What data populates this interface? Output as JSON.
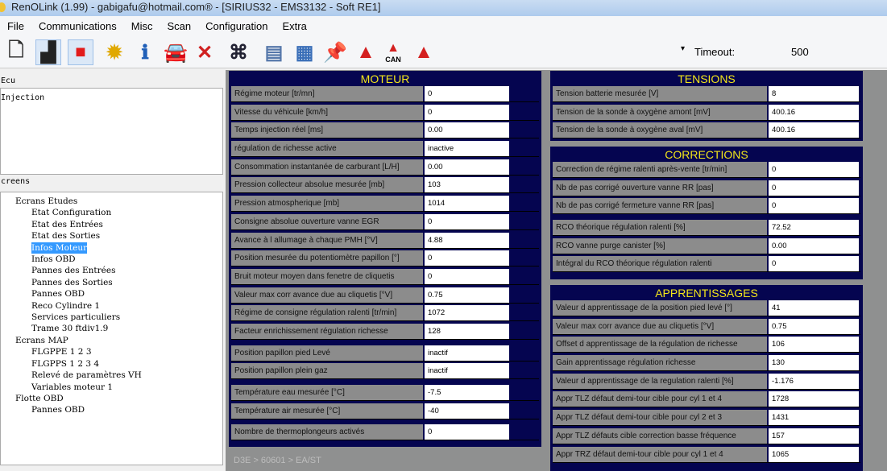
{
  "title": "RenOLink (1.99) - gabigafu@hotmail.com® -  [SIRIUS32 - EMS3132 - Soft RE1]",
  "menu": [
    "File",
    "Communications",
    "Misc",
    "Scan",
    "Configuration",
    "Extra"
  ],
  "toolbar": {
    "icons": [
      "new-file",
      "step",
      "stop",
      "gear",
      "info",
      "car-scan",
      "close",
      "binoculars",
      "shredder",
      "control-panel",
      "pin",
      "warning",
      "warning-can",
      "warning-clear"
    ],
    "can_label": "CAN",
    "timeout_label": "Timeout:",
    "timeout_value": "500"
  },
  "left": {
    "ecu_label": "Ecu",
    "ecu_items": [
      "Injection"
    ],
    "screens_label": "creens",
    "tree": [
      {
        "label": "Ecrans Etudes",
        "children": [
          "Etat Configuration",
          "Etat des Entrées",
          "Etat des Sorties",
          "Infos Moteur",
          "Infos OBD",
          "Pannes des Entrées",
          "Pannes des Sorties",
          "Pannes OBD",
          "Reco Cylindre 1",
          "Services particuliers",
          "Trame 30 ftdiv1.9"
        ]
      },
      {
        "label": "Ecrans MAP",
        "children": [
          "FLGPPE 1 2 3",
          "FLGPPS 1 2 3 4",
          "Relevé de paramètres VH",
          "Variables moteur 1"
        ]
      },
      {
        "label": "Flotte OBD",
        "children": [
          "Pannes OBD"
        ]
      }
    ],
    "selected": "Infos Moteur"
  },
  "panels": {
    "moteur": {
      "title": "MOTEUR",
      "groups": [
        [
          [
            "Régime moteur [tr/mn]",
            "0"
          ],
          [
            "Vitesse du véhicule [km/h]",
            "0"
          ],
          [
            "Temps injection réel [ms]",
            "0.00"
          ],
          [
            "régulation de richesse active",
            "inactive"
          ],
          [
            "Consommation instantanée de carburant [L/H]",
            "0.00"
          ],
          [
            "Pression collecteur absolue mesurée [mb]",
            "103"
          ],
          [
            "Pression atmospherique [mb]",
            "1014"
          ],
          [
            "Consigne absolue ouverture vanne EGR",
            "0"
          ],
          [
            "Avance à l allumage à chaque PMH [°V]",
            "4.88"
          ],
          [
            "Position mesurée du potentiomètre papillon [°]",
            "0"
          ],
          [
            "Bruit moteur moyen dans fenetre de cliquetis",
            "0"
          ],
          [
            "Valeur max corr avance due au cliquetis [°V]",
            "0.75"
          ],
          [
            "Régime de consigne régulation ralenti [tr/min]",
            "1072"
          ],
          [
            "Facteur enrichissement régulation richesse",
            "128"
          ]
        ],
        [
          [
            "Position papillon pied Levé",
            "inactif"
          ],
          [
            "Position papillon plein gaz",
            "inactif"
          ]
        ],
        [
          [
            "Température eau mesurée [°C]",
            "-7.5"
          ],
          [
            "Température air mesurée [°C]",
            "-40"
          ]
        ],
        [
          [
            "Nombre de thermoplongeurs activés",
            "0"
          ]
        ]
      ]
    },
    "tensions": {
      "title": "TENSIONS",
      "groups": [
        [
          [
            "Tension batterie mesurée [V]",
            "8"
          ],
          [
            "Tension de la sonde à oxygène amont [mV]",
            "400.16"
          ],
          [
            "Tension de la sonde à oxygène aval [mV]",
            "400.16"
          ]
        ]
      ]
    },
    "corrections": {
      "title": "CORRECTIONS",
      "groups": [
        [
          [
            "Correction de régime ralenti après-vente [tr/min]",
            "0"
          ],
          [
            "Nb de pas corrigé ouverture vanne RR [pas]",
            "0"
          ],
          [
            "Nb de pas corrigé fermeture vanne RR [pas]",
            "0"
          ]
        ],
        [
          [
            "RCO théorique régulation ralenti [%]",
            "72.52"
          ],
          [
            "RCO vanne purge canister [%]",
            "0.00"
          ],
          [
            "Intégral du RCO théorique régulation ralenti",
            "0"
          ]
        ]
      ]
    },
    "apprentissages": {
      "title": "APPRENTISSAGES",
      "groups": [
        [
          [
            "Valeur d apprentissage de la position pied levé [°]",
            "41"
          ],
          [
            "Valeur max corr avance due au cliquetis [°V]",
            "0.75"
          ],
          [
            "Offset d apprentissage de la régulation de richesse",
            "106"
          ],
          [
            "Gain apprentissage régulation richesse",
            "130"
          ],
          [
            "Valeur d apprentissage de la regulation ralenti [%]",
            "-1.176"
          ],
          [
            "Appr TLZ défaut demi-tour cible pour cyl 1 et 4",
            "1728"
          ],
          [
            "Appr TLZ défaut demi-tour cible pour cyl 2 et 3",
            "1431"
          ],
          [
            "Appr TLZ défauts cible correction basse fréquence",
            "157"
          ],
          [
            "Appr TRZ défaut demi-tour cible pour cyl 1 et 4",
            "1065"
          ]
        ]
      ]
    }
  },
  "footer": "D3E > 60601 > EA/ST"
}
